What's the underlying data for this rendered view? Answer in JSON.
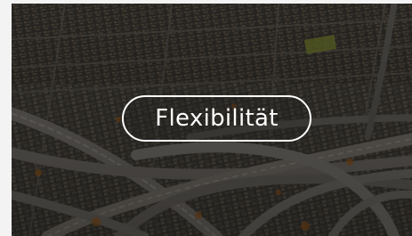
{
  "card": {
    "image": "aerial-city-freeway-interchange",
    "overlay_color": "#000000",
    "button_label": "Flexibilität",
    "button_border_color": "#ffffff",
    "button_text_color": "#ffffff"
  }
}
